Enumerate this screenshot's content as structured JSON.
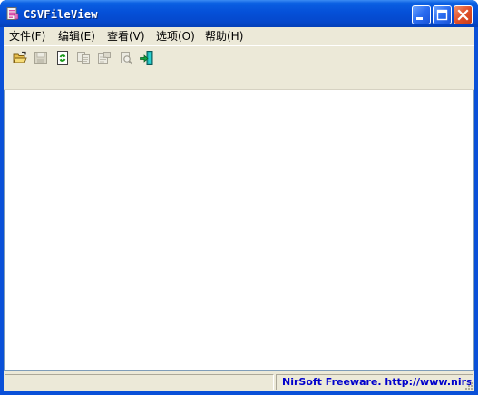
{
  "window": {
    "title": "CSVFileView",
    "icon": "csv-document-icon",
    "controls": [
      "minimize-icon",
      "maximize-icon",
      "close-icon"
    ]
  },
  "menu": {
    "items": [
      {
        "label": "文件(F)"
      },
      {
        "label": "编辑(E)"
      },
      {
        "label": "查看(V)"
      },
      {
        "label": "选项(O)"
      },
      {
        "label": "帮助(H)"
      }
    ]
  },
  "toolbar": {
    "buttons": [
      {
        "icon": "open-folder-icon",
        "enabled": true
      },
      {
        "icon": "save-icon",
        "enabled": false
      },
      {
        "icon": "refresh-icon",
        "enabled": true
      },
      {
        "icon": "copy-icon",
        "enabled": false
      },
      {
        "icon": "properties-icon",
        "enabled": false
      },
      {
        "icon": "find-icon",
        "enabled": false
      },
      {
        "icon": "exit-icon",
        "enabled": true
      }
    ]
  },
  "statusbar": {
    "left_text": "",
    "right_text": "NirSoft Freeware.  http://www.nirsoft.net"
  },
  "colors": {
    "titlebar": "#0550d8",
    "chrome": "#ece9d8",
    "status_link": "#0000cc"
  }
}
